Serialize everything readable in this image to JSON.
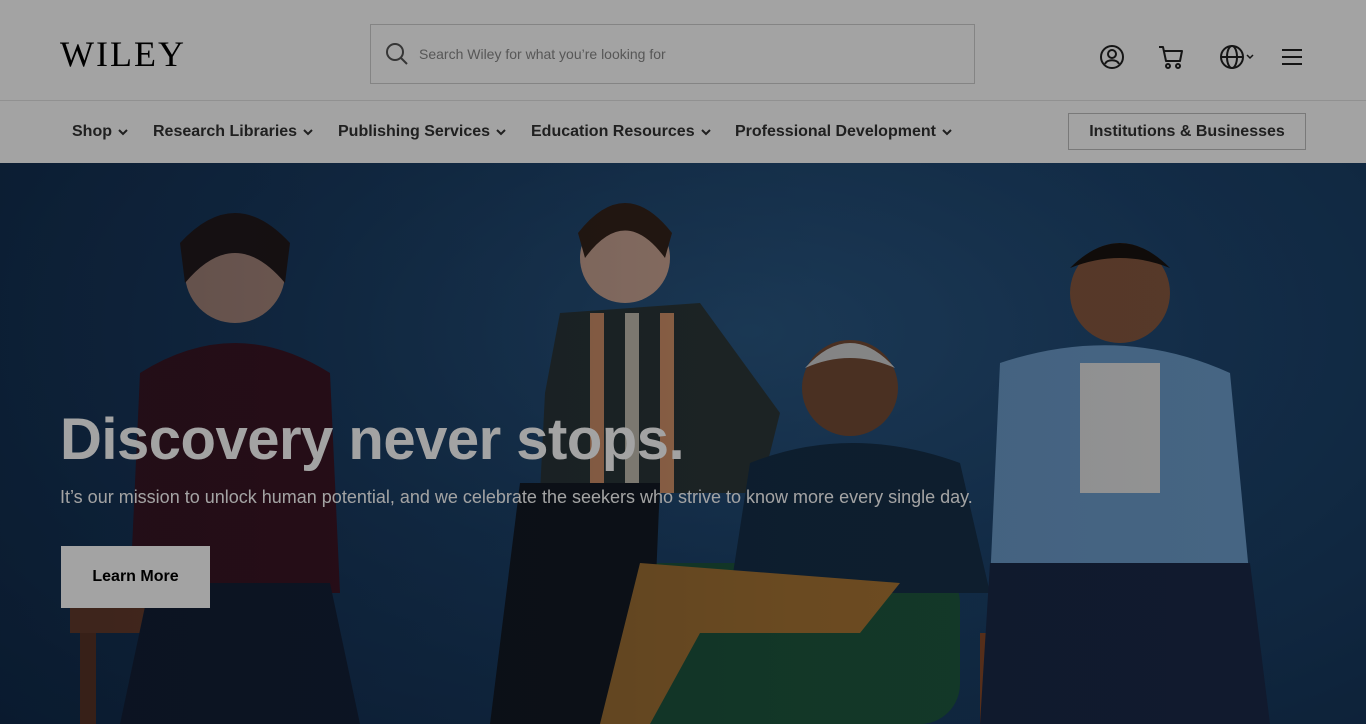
{
  "header": {
    "logo_text": "WILEY",
    "search": {
      "placeholder": "Search Wiley for what you’re looking for",
      "value": ""
    },
    "icons": [
      "account-icon",
      "cart-icon",
      "globe-icon",
      "menu-icon"
    ]
  },
  "nav": {
    "items": [
      {
        "label": "Shop"
      },
      {
        "label": "Research Libraries"
      },
      {
        "label": "Publishing Services"
      },
      {
        "label": "Education Resources"
      },
      {
        "label": "Professional Development"
      }
    ],
    "institutions_label": "Institutions & Businesses"
  },
  "hero": {
    "title": "Discovery never stops.",
    "subtitle": "It’s our mission to unlock human potential, and we celebrate the seekers who strive to know more every single day.",
    "cta_label": "Learn More"
  },
  "colors": {
    "hero_background": "#1e4670",
    "overlay": "rgba(0,0,0,0.36)",
    "text_dark": "#333333"
  }
}
